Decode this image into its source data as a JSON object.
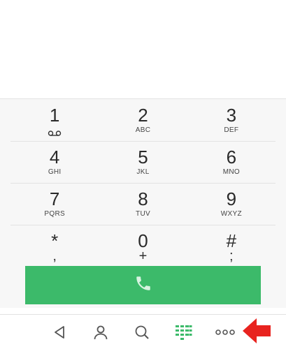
{
  "keypad": {
    "rows": [
      [
        {
          "digit": "1",
          "letters": "",
          "sub": "voicemail-icon"
        },
        {
          "digit": "2",
          "letters": "ABC"
        },
        {
          "digit": "3",
          "letters": "DEF"
        }
      ],
      [
        {
          "digit": "4",
          "letters": "GHI"
        },
        {
          "digit": "5",
          "letters": "JKL"
        },
        {
          "digit": "6",
          "letters": "MNO"
        }
      ],
      [
        {
          "digit": "7",
          "letters": "PQRS"
        },
        {
          "digit": "8",
          "letters": "TUV"
        },
        {
          "digit": "9",
          "letters": "WXYZ"
        }
      ],
      [
        {
          "digit": "*",
          "letters": ","
        },
        {
          "digit": "0",
          "letters": "+"
        },
        {
          "digit": "#",
          "letters": ";"
        }
      ]
    ]
  },
  "call_button": {
    "icon": "phone-icon",
    "color": "#3cba6a"
  },
  "navbar": {
    "items": [
      {
        "icon": "back-triangle-icon"
      },
      {
        "icon": "contacts-icon"
      },
      {
        "icon": "search-icon"
      },
      {
        "icon": "dialpad-icon",
        "active": true,
        "color": "#3cba6a"
      },
      {
        "icon": "more-options-icon"
      }
    ]
  },
  "annotation": {
    "icon": "red-arrow-icon",
    "color": "#e8231f"
  }
}
